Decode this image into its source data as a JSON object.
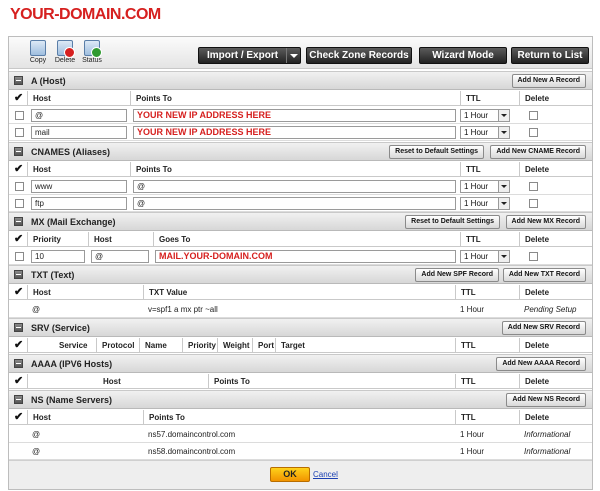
{
  "logo": "YOUR-DOMAIN.COM",
  "toolbar": {
    "copy": "Copy",
    "delete": "Delete",
    "status": "Status",
    "import_export": "Import / Export",
    "check_zone": "Check Zone Records",
    "wizard": "Wizard Mode",
    "return": "Return to List"
  },
  "common": {
    "reset": "Reset to Default Settings",
    "ttl_hdr": "TTL",
    "delete_hdr": "Delete",
    "check": "✔"
  },
  "a": {
    "title": "A (Host)",
    "add": "Add New A Record",
    "cols": {
      "host": "Host",
      "points": "Points To"
    },
    "rows": [
      {
        "host": "@",
        "points": "YOUR NEW IP ADDRESS HERE",
        "ttl": "1 Hour"
      },
      {
        "host": "mail",
        "points": "YOUR NEW IP ADDRESS HERE",
        "ttl": "1 Hour"
      }
    ]
  },
  "cname": {
    "title": "CNAMES (Aliases)",
    "add": "Add New CNAME Record",
    "cols": {
      "host": "Host",
      "points": "Points To"
    },
    "rows": [
      {
        "host": "www",
        "points": "@",
        "ttl": "1 Hour"
      },
      {
        "host": "ftp",
        "points": "@",
        "ttl": "1 Hour"
      }
    ]
  },
  "mx": {
    "title": "MX (Mail Exchange)",
    "add": "Add New MX Record",
    "cols": {
      "priority": "Priority",
      "host": "Host",
      "goes": "Goes To"
    },
    "rows": [
      {
        "priority": "10",
        "host": "@",
        "goes": "MAIL.YOUR-DOMAIN.COM",
        "ttl": "1 Hour"
      }
    ]
  },
  "txt": {
    "title": "TXT (Text)",
    "add_spf": "Add New SPF Record",
    "add": "Add New TXT Record",
    "cols": {
      "host": "Host",
      "value": "TXT Value"
    },
    "rows": [
      {
        "host": "@",
        "value": "v=spf1 a mx ptr ~all",
        "ttl": "1 Hour",
        "delete": "Pending Setup"
      }
    ]
  },
  "srv": {
    "title": "SRV (Service)",
    "add": "Add New SRV Record",
    "cols": {
      "service": "Service",
      "protocol": "Protocol",
      "name": "Name",
      "priority": "Priority",
      "weight": "Weight",
      "port": "Port",
      "target": "Target"
    }
  },
  "aaaa": {
    "title": "AAAA (IPV6 Hosts)",
    "add": "Add New AAAA Record",
    "cols": {
      "host": "Host",
      "points": "Points To"
    }
  },
  "ns": {
    "title": "NS (Name Servers)",
    "add": "Add New NS Record",
    "cols": {
      "host": "Host",
      "points": "Points To"
    },
    "rows": [
      {
        "host": "@",
        "points": "ns57.domaincontrol.com",
        "ttl": "1 Hour",
        "delete": "Informational"
      },
      {
        "host": "@",
        "points": "ns58.domaincontrol.com",
        "ttl": "1 Hour",
        "delete": "Informational"
      }
    ]
  },
  "footer": {
    "ok": "OK",
    "cancel": "Cancel"
  }
}
